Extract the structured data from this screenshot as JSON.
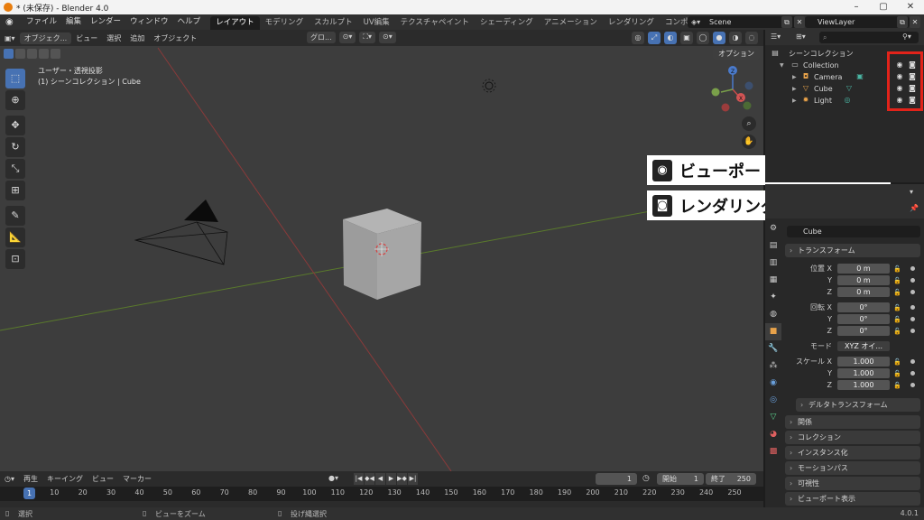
{
  "title_bar": {
    "title": "* (未保存) - Blender 4.0"
  },
  "menu": {
    "items": [
      "ファイル",
      "編集",
      "レンダー",
      "ウィンドウ",
      "ヘルプ"
    ],
    "workspaces": [
      "レイアウト",
      "モデリング",
      "スカルプト",
      "UV編集",
      "テクスチャペイント",
      "シェーディング",
      "アニメーション",
      "レンダリング",
      "コンポジティング"
    ],
    "active_workspace": "レイアウト",
    "scene": "Scene",
    "view_layer": "ViewLayer"
  },
  "viewport": {
    "mode": "オブジェク...",
    "menus": [
      "ビュー",
      "選択",
      "追加",
      "オブジェクト"
    ],
    "transform_orientation": "グロ...",
    "options": "オプション",
    "view_name": "ユーザー・透視投影",
    "collection_info": "(1) シーンコレクション | Cube"
  },
  "callout": {
    "viewport_label": "ビューポートで表示・非表示",
    "render_label": "レンダリングで表示・非表示",
    "viewport_icon": "eye-icon",
    "render_icon": "camera-icon"
  },
  "outliner": {
    "root": "シーンコレクション",
    "collection": "Collection",
    "objects": [
      {
        "name": "Camera",
        "icon": "camera-object-icon",
        "color": "#e8a24a"
      },
      {
        "name": "Cube",
        "icon": "mesh-object-icon",
        "color": "#e8a24a"
      },
      {
        "name": "Light",
        "icon": "light-object-icon",
        "color": "#e8a24a"
      }
    ]
  },
  "properties": {
    "object_name": "Cube",
    "transform_header": "トランスフォーム",
    "location_label": "位置",
    "rotation_label": "回転",
    "scale_label": "スケール",
    "mode_label": "モード",
    "mode_value": "XYZ オイ...",
    "location": {
      "x": "0 m",
      "y": "0 m",
      "z": "0 m"
    },
    "rotation": {
      "x": "0°",
      "y": "0°",
      "z": "0°"
    },
    "scale": {
      "x": "1.000",
      "y": "1.000",
      "z": "1.000"
    },
    "axis_labels": {
      "x": "X",
      "y": "Y",
      "z": "Z"
    },
    "delta_transform": "デルタトランスフォーム",
    "panels": [
      "関係",
      "コレクション",
      "インスタンス化",
      "モーションパス",
      "可視性",
      "ビューポート表示"
    ]
  },
  "timeline": {
    "menus": [
      "再生",
      "キーイング",
      "ビュー",
      "マーカー"
    ],
    "current_frame": "1",
    "start_label": "開始",
    "start": "1",
    "end_label": "終了",
    "end": "250",
    "ticks": [
      "1",
      "10",
      "20",
      "30",
      "40",
      "50",
      "60",
      "70",
      "80",
      "90",
      "100",
      "110",
      "120",
      "130",
      "140",
      "150",
      "160",
      "170",
      "180",
      "190",
      "200",
      "210",
      "220",
      "230",
      "240",
      "250"
    ]
  },
  "status": {
    "select": "選択",
    "zoom": "ビューをズーム",
    "lasso": "投げ縄選択",
    "version": "4.0.1"
  }
}
